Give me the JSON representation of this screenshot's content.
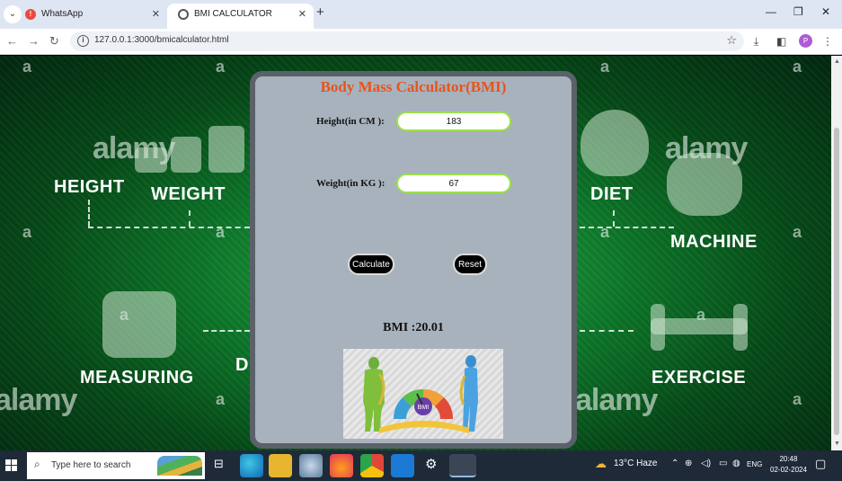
{
  "browser": {
    "tabs": [
      {
        "label": "WhatsApp",
        "active": false
      },
      {
        "label": "BMI CALCULATOR",
        "active": true
      }
    ],
    "url": "127.0.0.1:3000/bmicalculator.html",
    "profile_initial": "P"
  },
  "background": {
    "labels": [
      "HEIGHT",
      "WEIGHT",
      "DIET",
      "MACHINE",
      "MEASURING",
      "EXERCISE",
      "D"
    ],
    "watermark": "alamy",
    "watermark_letter": "a",
    "accent_color": "#0e7a2b"
  },
  "calculator": {
    "title": "Body Mass Calculator(BMI)",
    "height_label": "Height(in CM ):",
    "height_value": "183",
    "weight_label": "Weight(in KG ):",
    "weight_value": "67",
    "calculate_label": "Calculate",
    "reset_label": "Reset",
    "result_text": "BMI :20.01",
    "image_label": "BMI",
    "title_color": "#e8541c",
    "input_border_color": "#9be04a"
  },
  "taskbar": {
    "search_placeholder": "Type here to search",
    "weather": "13°C  Haze",
    "language": "ENG",
    "time": "20:48",
    "date": "02-02-2024"
  }
}
